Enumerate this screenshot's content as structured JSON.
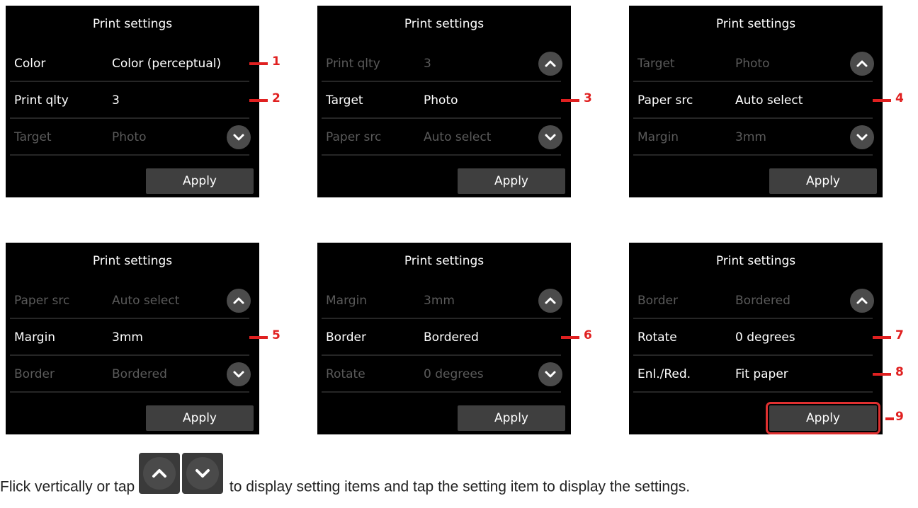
{
  "panels": [
    {
      "title": "Print settings",
      "rows": [
        {
          "label": "Color",
          "value": "Color (perceptual)"
        },
        {
          "label": "Print qlty",
          "value": "3"
        },
        {
          "label": "Target",
          "value": "Photo"
        }
      ],
      "apply": "Apply"
    },
    {
      "title": "Print settings",
      "rows": [
        {
          "label": "Print qlty",
          "value": "3"
        },
        {
          "label": "Target",
          "value": "Photo"
        },
        {
          "label": "Paper src",
          "value": "Auto select"
        }
      ],
      "apply": "Apply"
    },
    {
      "title": "Print settings",
      "rows": [
        {
          "label": "Target",
          "value": "Photo"
        },
        {
          "label": "Paper src",
          "value": "Auto select"
        },
        {
          "label": "Margin",
          "value": "3mm"
        }
      ],
      "apply": "Apply"
    },
    {
      "title": "Print settings",
      "rows": [
        {
          "label": "Paper src",
          "value": "Auto select"
        },
        {
          "label": "Margin",
          "value": "3mm"
        },
        {
          "label": "Border",
          "value": "Bordered"
        }
      ],
      "apply": "Apply"
    },
    {
      "title": "Print settings",
      "rows": [
        {
          "label": "Margin",
          "value": "3mm"
        },
        {
          "label": "Border",
          "value": "Bordered"
        },
        {
          "label": "Rotate",
          "value": "0 degrees"
        }
      ],
      "apply": "Apply"
    },
    {
      "title": "Print settings",
      "rows": [
        {
          "label": "Border",
          "value": "Bordered"
        },
        {
          "label": "Rotate",
          "value": "0 degrees"
        },
        {
          "label": "Enl./Red.",
          "value": "Fit paper"
        }
      ],
      "apply": "Apply"
    }
  ],
  "callouts": [
    "1",
    "2",
    "3",
    "4",
    "5",
    "6",
    "7",
    "8",
    "9"
  ],
  "instruction": {
    "before": "Flick vertically or tap",
    "after": "to display setting items and tap the setting item to display the settings."
  },
  "icons": {
    "up": "chevron-up-icon",
    "down": "chevron-down-icon"
  },
  "colors": {
    "panel_bg": "#000000",
    "callout": "#e02020",
    "button": "#3f3f3f",
    "nav_circle": "#4b4b4b"
  }
}
